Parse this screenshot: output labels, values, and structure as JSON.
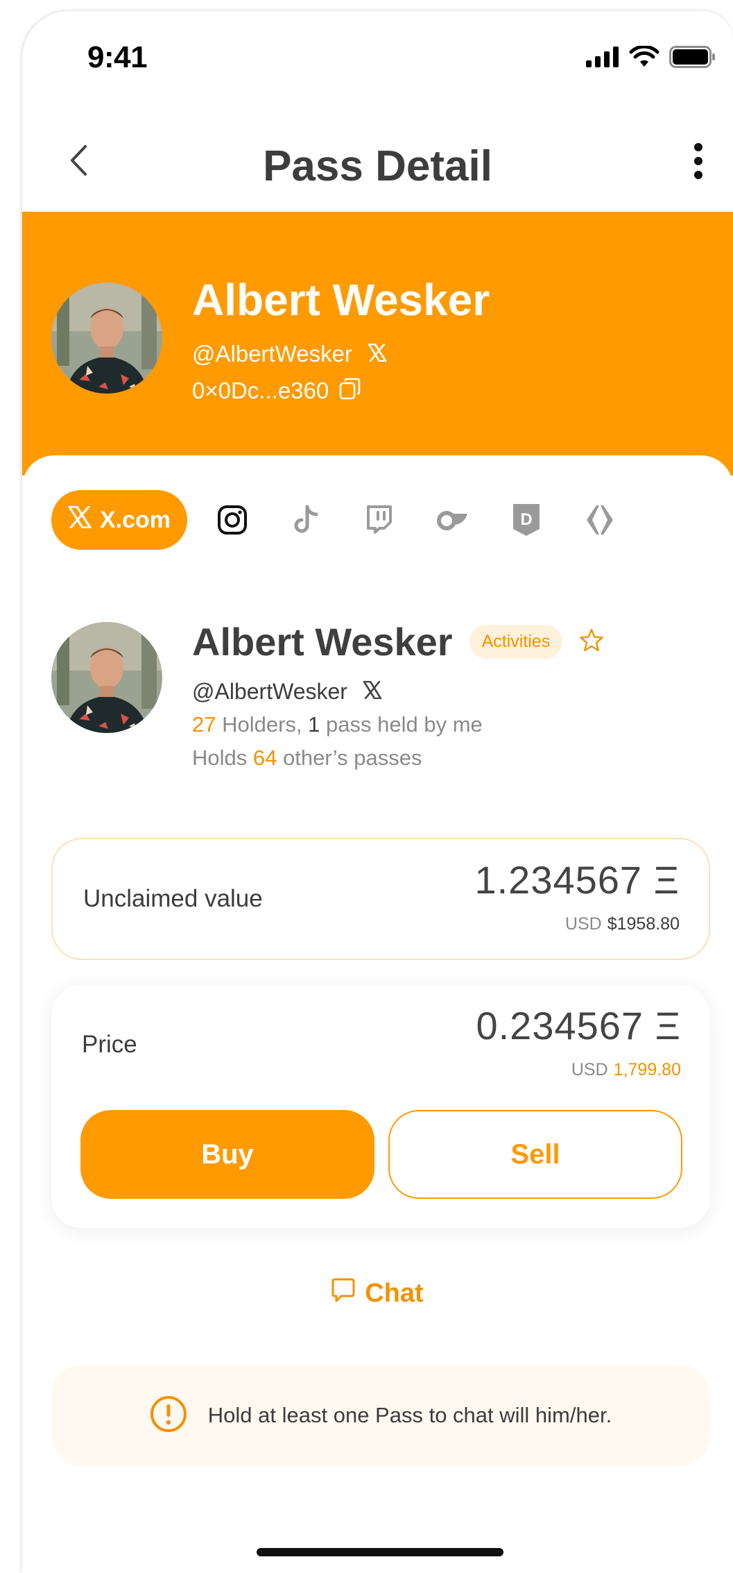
{
  "status_bar": {
    "time": "9:41"
  },
  "nav": {
    "title": "Pass Detail"
  },
  "header": {
    "name": "Albert Wesker",
    "handle": "@AlbertWesker",
    "address": "0×0Dc...e360"
  },
  "social_tabs": {
    "active_label": "X.com",
    "icons": [
      "x-icon",
      "instagram-icon",
      "tiktok-icon",
      "twitch-icon",
      "onlyfans-icon",
      "d-shield-icon",
      "diamond-logo-icon"
    ]
  },
  "profile": {
    "name": "Albert Wesker",
    "badge": "Activities",
    "handle": "@AlbertWesker",
    "holders_count": "27",
    "holders_text": " Holders, ",
    "held_by_me_count": "1",
    "held_by_me_text": " pass held by me",
    "holds_prefix": "Holds ",
    "holds_count": "64",
    "holds_suffix": " other’s passes"
  },
  "unclaimed": {
    "label": "Unclaimed value",
    "amount": "1.234567 Ξ",
    "usd_label": "USD",
    "usd_value": "$1958.80"
  },
  "price": {
    "label": "Price",
    "amount": "0.234567 Ξ",
    "usd_label": "USD",
    "usd_value": "1,799.80",
    "buy_label": "Buy",
    "sell_label": "Sell"
  },
  "chat": {
    "label": "Chat"
  },
  "notice": {
    "text": "Hold at least one Pass to chat will him/her."
  },
  "colors": {
    "accent": "#FF9A00",
    "accent_text": "#F29200",
    "badge_bg": "#FFF1DC",
    "notice_bg": "#FFF9F1"
  }
}
